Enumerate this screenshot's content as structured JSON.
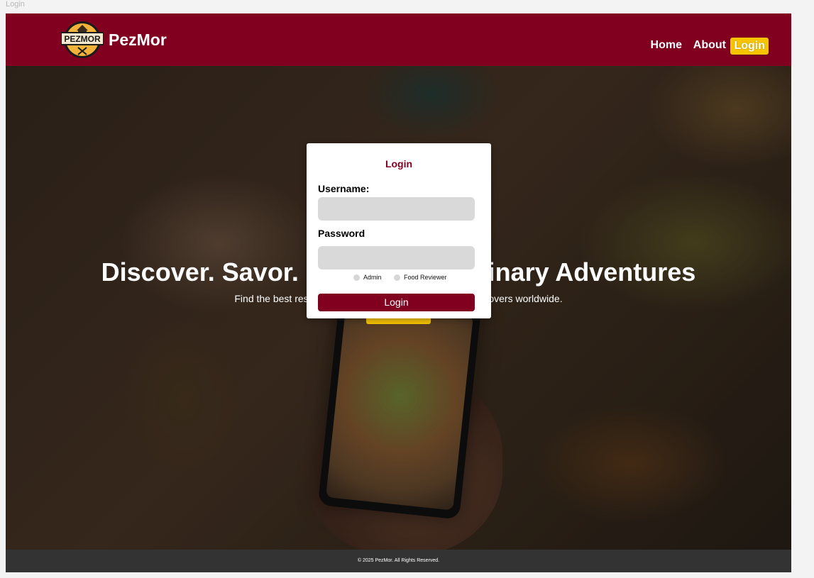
{
  "tab": {
    "caption": "Login"
  },
  "header": {
    "brand": "PezMor",
    "logo_text": "PEZMOR",
    "nav": {
      "home": "Home",
      "about": "About",
      "login": "Login"
    }
  },
  "hero": {
    "title": "Discover. Savor. Share Your Culinary Adventures",
    "subtitle": "Find the best restaurants, share reviews, and follow food lovers worldwide."
  },
  "login_modal": {
    "title": "Login",
    "username_label": "Username:",
    "username_value": "",
    "password_label": "Password",
    "password_value": "",
    "roles": [
      "Admin",
      "Food Reviewer"
    ],
    "submit_label": "Login"
  },
  "footer": {
    "text": "© 2025 PezMor. All Rights Reserved."
  },
  "colors": {
    "brand": "#82001f",
    "accent": "#f6c400",
    "footer": "#333333",
    "input": "#d9d9d9"
  }
}
